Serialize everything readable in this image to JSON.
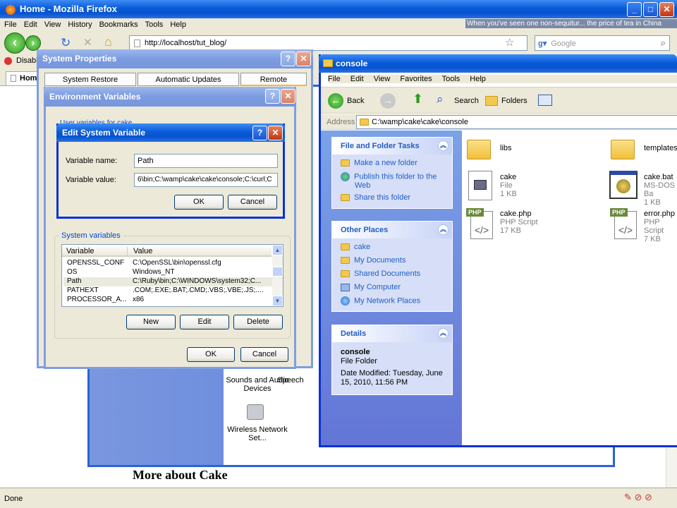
{
  "firefox": {
    "title": "Home - Mozilla Firefox",
    "menu": [
      "File",
      "Edit",
      "View",
      "History",
      "Bookmarks",
      "Tools",
      "Help"
    ],
    "url": "http://localhost/tut_blog/",
    "search_placeholder": "Google",
    "overlay_text": "When you've seen one non-sequitur... the price of tea in China",
    "bookmark_partial": "Disable",
    "tab_partial": "Hom",
    "status": "Done",
    "page_heading": "More about Cake"
  },
  "control_panel": {
    "items": [
      "Sounds and Audio Devices",
      "Speech",
      "Wireless Network Set..."
    ]
  },
  "system_properties": {
    "title": "System Properties",
    "tabs": [
      "System Restore",
      "Automatic Updates",
      "Remote"
    ]
  },
  "env_vars": {
    "title": "Environment Variables",
    "user_vars_partial": "User variables for cake",
    "system_vars_label": "System variables",
    "columns": [
      "Variable",
      "Value"
    ],
    "rows": [
      {
        "name": "OPENSSL_CONF",
        "value": "C:\\OpenSSL\\bin\\openssl.cfg"
      },
      {
        "name": "OS",
        "value": "Windows_NT"
      },
      {
        "name": "Path",
        "value": "C:\\Ruby\\bin;C:\\WINDOWS\\system32;C..."
      },
      {
        "name": "PATHEXT",
        "value": ".COM;.EXE;.BAT;.CMD;.VBS;.VBE;.JS;...."
      },
      {
        "name": "PROCESSOR_A...",
        "value": "x86"
      }
    ],
    "buttons": [
      "New",
      "Edit",
      "Delete"
    ],
    "ok": "OK",
    "cancel": "Cancel"
  },
  "edit_var": {
    "title": "Edit System Variable",
    "name_label": "Variable name:",
    "name_value": "Path",
    "value_label": "Variable value:",
    "value_value": "6\\bin;C:\\wamp\\cake\\cake\\console;C:\\curl;C",
    "ok": "OK",
    "cancel": "Cancel"
  },
  "explorer": {
    "title": "console",
    "menu": [
      "File",
      "Edit",
      "View",
      "Favorites",
      "Tools",
      "Help"
    ],
    "back": "Back",
    "search": "Search",
    "folders": "Folders",
    "address_label": "Address",
    "address": "C:\\wamp\\cake\\cake\\console",
    "tasks_title": "File and Folder Tasks",
    "tasks": [
      "Make a new folder",
      "Publish this folder to the Web",
      "Share this folder"
    ],
    "places_title": "Other Places",
    "places": [
      "cake",
      "My Documents",
      "Shared Documents",
      "My Computer",
      "My Network Places"
    ],
    "details_title": "Details",
    "details_name": "console",
    "details_type": "File Folder",
    "details_date": "Date Modified: Tuesday, June 15, 2010, 11:56 PM",
    "files": [
      {
        "name": "libs",
        "type": "",
        "size": ""
      },
      {
        "name": "templates",
        "type": "",
        "size": ""
      },
      {
        "name": "cake",
        "type": "File",
        "size": "1 KB"
      },
      {
        "name": "cake.bat",
        "type": "MS-DOS Ba",
        "size": "1 KB"
      },
      {
        "name": "cake.php",
        "type": "PHP Script",
        "size": "17 KB"
      },
      {
        "name": "error.php",
        "type": "PHP Script",
        "size": "7 KB"
      }
    ],
    "php_badge": "PHP"
  }
}
